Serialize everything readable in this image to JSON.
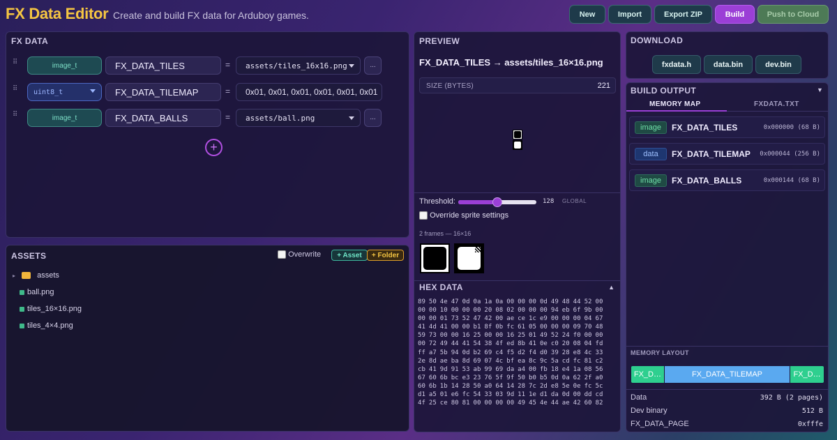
{
  "header": {
    "title": "FX Data Editor",
    "subtitle": "Create and build FX data for Arduboy games.",
    "buttons": {
      "new": "New",
      "import": "Import",
      "export": "Export ZIP",
      "build": "Build",
      "push": "Push to Cloud"
    }
  },
  "fx_data": {
    "title": "FX DATA",
    "rows": [
      {
        "type": "image_t",
        "name": "FX_DATA_TILES",
        "eq": "=",
        "value": "assets/tiles_16x16.png",
        "more": "..."
      },
      {
        "type": "uint8_t",
        "name": "FX_DATA_TILEMAP",
        "eq": "=",
        "value": "0x01, 0x01, 0x01, 0x01, 0x01, 0x01"
      },
      {
        "type": "image_t",
        "name": "FX_DATA_BALLS",
        "eq": "=",
        "value": "assets/ball.png",
        "more": "..."
      }
    ],
    "add_symbol": "+"
  },
  "assets": {
    "title": "ASSETS",
    "overwrite_label": "Overwrite",
    "add_asset": "+ Asset",
    "add_folder": "+ Folder",
    "tree": {
      "folder": "assets",
      "files": [
        "ball.png",
        "tiles_16×16.png",
        "tiles_4×4.png"
      ]
    }
  },
  "preview": {
    "title": "PREVIEW",
    "heading": "FX_DATA_TILES → assets/tiles_16×16.png",
    "size_label": "SIZE (BYTES)",
    "size_value": "221",
    "threshold_label": "Threshold:",
    "threshold_value": "128",
    "threshold_fraction": 0.5,
    "threshold_scope": "GLOBAL",
    "override_label": "Override sprite settings",
    "frames_info": "2 frames — 16×16"
  },
  "hex": {
    "title": "HEX DATA",
    "collapse": "▲",
    "lines": [
      "89 50 4e 47 0d 0a 1a 0a 00 00 00 0d 49 48 44 52 00",
      "00 00 10 00 00 00 20 08 02 00 00 00 94 eb 6f 9b 00",
      "00 00 01 73 52 47 42 00 ae ce 1c e9 00 00 00 04 67",
      "41 4d 41 00 00 b1 8f 0b fc 61 05 00 00 00 09 70 48",
      "59 73 00 00 16 25 00 00 16 25 01 49 52 24 f0 00 00",
      "00 72 49 44 41 54 38 4f ed 8b 41 0e c0 20 08 04 fd",
      "ff a7 5b 94 0d b2 69 c4 f5 d2 f4 d0 39 28 e8 4c 33",
      "2e 8d ae ba 8d 69 07 4c bf ea 8c 9c 5a cd fc 81 c2",
      "cb 41 9d 91 53 ab 99 69 da a4 00 fb 18 e4 1a 08 56",
      "67 60 6b bc e3 23 76 5f 9f 50 b0 b5 0d 0a 62 2f a0",
      "60 6b 1b 14 28 50 a0 64 14 28 7c 2d e8 5e 0e fc 5c",
      "d1 a5 01 e6 fc 54 33 03 9d 11 1e d1 da 0d 00 dd cd",
      "4f 25 ce 80 81 00 00 00 00 49 45 4e 44 ae 42 60 82"
    ]
  },
  "download": {
    "title": "DOWNLOAD",
    "buttons": [
      "fxdata.h",
      "data.bin",
      "dev.bin"
    ]
  },
  "build_output": {
    "title": "BUILD OUTPUT",
    "toggle": "▼",
    "tabs": [
      "MEMORY MAP",
      "FXDATA.TXT"
    ],
    "memory_map": [
      {
        "badge": "image",
        "name": "FX_DATA_TILES",
        "addr": "0x000000 (68 B)"
      },
      {
        "badge": "data",
        "name": "FX_DATA_TILEMAP",
        "addr": "0x000044 (256 B)"
      },
      {
        "badge": "image",
        "name": "FX_DATA_BALLS",
        "addr": "0x000144 (68 B)"
      }
    ],
    "layout_title": "MEMORY LAYOUT",
    "layout_segments": [
      {
        "label": "FX_D…",
        "bytes": 68,
        "color": "#2ecf8f"
      },
      {
        "label": "FX_DATA_TILEMAP",
        "bytes": 256,
        "color": "#5aa9f0"
      },
      {
        "label": "FX_D…",
        "bytes": 68,
        "color": "#2ecf8f"
      }
    ],
    "stats": [
      {
        "label": "Data",
        "value": "392 B (2 pages)"
      },
      {
        "label": "Dev binary",
        "value": "512 B"
      },
      {
        "label": "FX_DATA_PAGE",
        "value": "0xfffe"
      }
    ]
  },
  "colors": {
    "accent": "#9b3fd6",
    "title": "#f5c542",
    "teal": "#3fb98a"
  }
}
